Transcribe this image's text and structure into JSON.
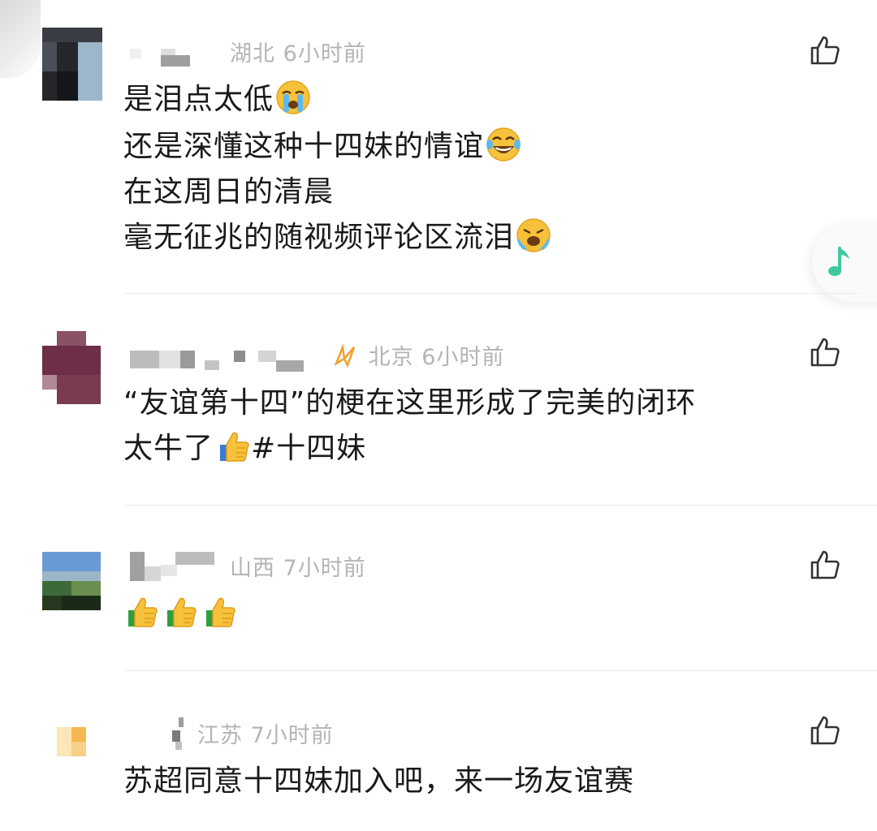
{
  "comments": [
    {
      "location": "湖北",
      "time": "6小时前",
      "lines": [
        {
          "text": "是泪点太低",
          "emoji": "crying-face"
        },
        {
          "text": "还是深懂这种十四妹的情谊",
          "emoji": "tears-of-joy-face"
        },
        {
          "text": "在这周日的清晨",
          "emoji": null
        },
        {
          "text": "毫无征兆的随视频评论区流泪",
          "emoji": "loudly-crying-face"
        }
      ]
    },
    {
      "location": "北京",
      "time": "6小时前",
      "lines": [
        {
          "text": "“友谊第十四”的梗在这里形成了完美的闭环",
          "emoji": null
        },
        {
          "text": "太牛了",
          "emoji": "thumbs-up",
          "suffix": "#十四妹"
        }
      ]
    },
    {
      "location": "山西",
      "time": "7小时前",
      "lines": [
        {
          "text": "",
          "emoji": "thumbs-up x3"
        }
      ]
    },
    {
      "location": "江苏",
      "time": "7小时前",
      "lines": [
        {
          "text": "苏超同意十四妹加入吧，来一场友谊赛",
          "emoji": null
        }
      ]
    }
  ],
  "icons": {
    "like": "thumbs-up-outline-icon",
    "music": "music-note-icon",
    "badge": "sparkle-badge-icon"
  },
  "colors": {
    "meta_text": "#b4b4b4",
    "body_text": "#1a1a1a",
    "music_note": "#3ec8a0",
    "badge": "#f0a030"
  }
}
